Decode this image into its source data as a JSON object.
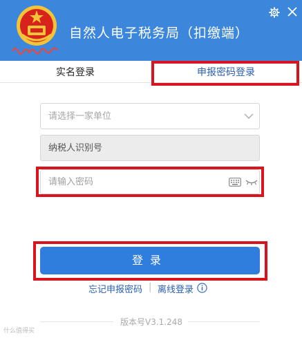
{
  "window": {
    "title": "自然人电子税务局（扣缴端）"
  },
  "tabs": [
    {
      "label": "实名登录",
      "active": false
    },
    {
      "label": "申报密码登录",
      "active": true
    }
  ],
  "form": {
    "unit_select_placeholder": "请选择一家单位",
    "taxpayer_id_label": "纳税人识别号",
    "password_placeholder": "请输入密码",
    "login_label": "登录"
  },
  "links": {
    "forgot": "忘记申报密码",
    "separator": "|",
    "offline": "离线登录"
  },
  "footer": {
    "version": "版本号V3.1.248",
    "watermark": "什么值得买"
  },
  "colors": {
    "header": "#3c87dc",
    "primary_button": "#2f7ddc",
    "link": "#2a5fb4",
    "highlight": "#d8141e",
    "disabled_field": "#ececec"
  },
  "icons": [
    "emblem-icon",
    "gear-icon",
    "close-icon",
    "chevron-down-icon",
    "keyboard-icon",
    "eye-closed-icon",
    "info-icon"
  ]
}
